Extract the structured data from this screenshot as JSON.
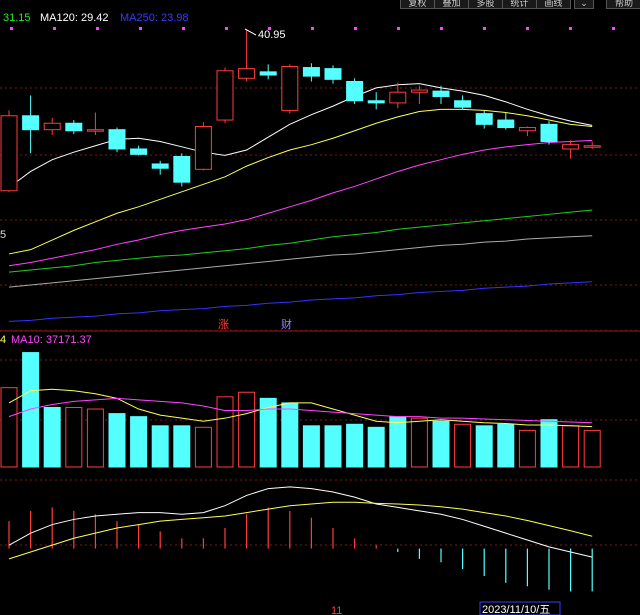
{
  "window": {
    "toolbar": [
      "复权",
      "叠加",
      "多股",
      "统计",
      "画线",
      "⌄",
      "帮助"
    ]
  },
  "price_legend": {
    "first_value": "31.15",
    "ma120": "MA120: 29.42",
    "ma250": "MA250: 23.98",
    "left_cut_label": "5"
  },
  "max_price_label": "40.95",
  "markers": {
    "zhang": "涨",
    "cai": "财"
  },
  "volume_legend": {
    "first_value": "4",
    "ma10": "MA10: 37171.37"
  },
  "axis": {
    "x_tick": "11",
    "date_label": "2023/11/10/五"
  },
  "colors": {
    "up": "#ff3c3c",
    "down": "#54ffff",
    "ma_short": "#ffffff",
    "ma_mid": "#ffff55",
    "ma_pink": "#ff44ff",
    "ma_green": "#22cc22",
    "ma_gray": "#aaaaaa",
    "ma_blue": "#3333ff",
    "grid": "#7a1a1a"
  },
  "chart_data": [
    {
      "type": "candlestick",
      "title": "",
      "series": [
        {
          "name": "price",
          "values": [
            {
              "o": 26.0,
              "h": 33.5,
              "l": 25.9,
              "c": 33.0
            },
            {
              "o": 33.0,
              "h": 34.9,
              "l": 29.5,
              "c": 31.7
            },
            {
              "o": 31.7,
              "h": 32.8,
              "l": 31.2,
              "c": 32.3
            },
            {
              "o": 32.3,
              "h": 32.6,
              "l": 31.3,
              "c": 31.6
            },
            {
              "o": 31.6,
              "h": 33.3,
              "l": 31.2,
              "c": 31.7
            },
            {
              "o": 31.7,
              "h": 31.9,
              "l": 29.6,
              "c": 29.9
            },
            {
              "o": 29.9,
              "h": 30.2,
              "l": 29.3,
              "c": 29.4
            },
            {
              "o": 28.5,
              "h": 28.8,
              "l": 27.5,
              "c": 28.1
            },
            {
              "o": 29.2,
              "h": 29.5,
              "l": 26.4,
              "c": 26.8
            },
            {
              "o": 28.0,
              "h": 32.4,
              "l": 27.9,
              "c": 32.0
            },
            {
              "o": 32.6,
              "h": 37.5,
              "l": 32.3,
              "c": 37.2
            },
            {
              "o": 36.5,
              "h": 40.95,
              "l": 36.2,
              "c": 37.4
            },
            {
              "o": 37.1,
              "h": 37.8,
              "l": 36.4,
              "c": 36.8
            },
            {
              "o": 33.5,
              "h": 37.8,
              "l": 33.2,
              "c": 37.6
            },
            {
              "o": 37.5,
              "h": 37.9,
              "l": 36.2,
              "c": 36.7
            },
            {
              "o": 37.4,
              "h": 37.7,
              "l": 36.0,
              "c": 36.4
            },
            {
              "o": 36.2,
              "h": 36.5,
              "l": 34.1,
              "c": 34.4
            },
            {
              "o": 34.4,
              "h": 35.2,
              "l": 33.6,
              "c": 34.2
            },
            {
              "o": 34.2,
              "h": 36.1,
              "l": 33.7,
              "c": 35.2
            },
            {
              "o": 35.2,
              "h": 35.8,
              "l": 34.1,
              "c": 35.4
            },
            {
              "o": 35.3,
              "h": 35.8,
              "l": 34.1,
              "c": 34.8
            },
            {
              "o": 34.4,
              "h": 34.9,
              "l": 33.6,
              "c": 33.8
            },
            {
              "o": 33.2,
              "h": 33.5,
              "l": 31.8,
              "c": 32.2
            },
            {
              "o": 32.6,
              "h": 33.3,
              "l": 31.7,
              "c": 31.9
            },
            {
              "o": 31.6,
              "h": 32.0,
              "l": 31.1,
              "c": 31.9
            },
            {
              "o": 32.2,
              "h": 32.5,
              "l": 30.3,
              "c": 30.6
            },
            {
              "o": 29.9,
              "h": 30.7,
              "l": 29.0,
              "c": 30.3
            },
            {
              "o": 30.1,
              "h": 30.6,
              "l": 29.9,
              "c": 30.2
            }
          ]
        },
        {
          "name": "MA5",
          "values": [
            26.3,
            27.8,
            28.9,
            29.6,
            30.2,
            30.8,
            30.9,
            30.6,
            30.1,
            29.6,
            29.3,
            29.8,
            31.0,
            32.2,
            33.1,
            33.9,
            34.8,
            35.6,
            35.9,
            36.0,
            35.6,
            35.3,
            34.9,
            34.3,
            33.6,
            33.0,
            32.5,
            32.1
          ]
        },
        {
          "name": "MA20",
          "values": [
            20.1,
            20.5,
            21.4,
            22.3,
            23.1,
            23.9,
            24.5,
            25.2,
            25.9,
            26.6,
            27.3,
            28.3,
            29.1,
            29.8,
            30.3,
            30.9,
            31.6,
            32.3,
            32.9,
            33.4,
            33.6,
            33.6,
            33.5,
            33.3,
            33.0,
            32.6,
            32.2,
            32.0
          ]
        },
        {
          "name": "MA60",
          "values": [
            19.0,
            19.3,
            19.7,
            20.1,
            20.5,
            21.0,
            21.4,
            21.9,
            22.3,
            22.6,
            22.9,
            23.3,
            23.9,
            24.5,
            25.1,
            25.8,
            26.4,
            27.1,
            27.8,
            28.4,
            28.9,
            29.4,
            29.8,
            30.1,
            30.3,
            30.5,
            30.6,
            30.7
          ]
        },
        {
          "name": "MA120",
          "values": [
            18.4,
            18.6,
            18.8,
            19.0,
            19.3,
            19.5,
            19.7,
            19.9,
            20.0,
            20.2,
            20.4,
            20.6,
            20.9,
            21.1,
            21.4,
            21.7,
            21.9,
            22.1,
            22.4,
            22.6,
            22.8,
            23.0,
            23.2,
            23.4,
            23.6,
            23.8,
            24.0,
            24.2
          ]
        },
        {
          "name": "MA250",
          "values": [
            17.0,
            17.2,
            17.4,
            17.6,
            17.8,
            18.0,
            18.2,
            18.4,
            18.6,
            18.8,
            19.0,
            19.2,
            19.4,
            19.6,
            19.8,
            20.0,
            20.1,
            20.3,
            20.5,
            20.7,
            20.9,
            21.0,
            21.2,
            21.3,
            21.5,
            21.6,
            21.7,
            21.8
          ]
        },
        {
          "name": "MA_long",
          "values": [
            13.8,
            13.9,
            14.1,
            14.2,
            14.3,
            14.5,
            14.6,
            14.8,
            14.9,
            15.0,
            15.2,
            15.3,
            15.5,
            15.6,
            15.8,
            15.9,
            16.0,
            16.2,
            16.3,
            16.5,
            16.6,
            16.7,
            16.9,
            17.0,
            17.1,
            17.3,
            17.4,
            17.5
          ]
        }
      ],
      "ylim": [
        13,
        42.5
      ]
    },
    {
      "type": "bar",
      "title": "",
      "series": [
        {
          "name": "volume",
          "values": [
            52000,
            75000,
            39000,
            39000,
            38000,
            35000,
            33000,
            27000,
            27000,
            26000,
            46000,
            49000,
            45000,
            42000,
            27000,
            27000,
            28000,
            26000,
            33000,
            32000,
            30000,
            28000,
            27000,
            28000,
            24000,
            31000,
            27000,
            24000
          ],
          "up": [
            1,
            0,
            0,
            1,
            1,
            0,
            0,
            0,
            0,
            1,
            1,
            1,
            0,
            0,
            0,
            0,
            0,
            0,
            0,
            1,
            0,
            1,
            0,
            0,
            1,
            0,
            1,
            1
          ]
        },
        {
          "name": "MA5",
          "values": [
            42000,
            50000,
            51000,
            50000,
            48000,
            45000,
            38000,
            34000,
            32000,
            30000,
            32000,
            35000,
            39000,
            42000,
            42000,
            38000,
            34000,
            30000,
            29000,
            30000,
            31000,
            30000,
            29000,
            28500,
            27500,
            27500,
            27000,
            26500
          ]
        },
        {
          "name": "MA10",
          "values": [
            33000,
            38000,
            41000,
            43000,
            44000,
            45000,
            44000,
            43000,
            42000,
            40000,
            37000,
            37000,
            38000,
            38000,
            37000,
            36000,
            35000,
            34000,
            33000,
            33000,
            32000,
            32000,
            31500,
            31000,
            30500,
            30000,
            29500,
            29000
          ]
        }
      ],
      "ylim": [
        0,
        78000
      ]
    },
    {
      "type": "line",
      "title": "",
      "series": [
        {
          "name": "DIF",
          "values": [
            0.1,
            0.45,
            0.7,
            0.85,
            0.95,
            1.0,
            1.05,
            1.05,
            1.0,
            1.05,
            1.25,
            1.55,
            1.75,
            1.8,
            1.75,
            1.65,
            1.5,
            1.3,
            1.2,
            1.1,
            1.0,
            0.85,
            0.65,
            0.45,
            0.25,
            0.05,
            -0.1,
            -0.25
          ]
        },
        {
          "name": "DEA",
          "values": [
            -0.3,
            -0.1,
            0.1,
            0.3,
            0.45,
            0.6,
            0.7,
            0.8,
            0.85,
            0.9,
            0.95,
            1.05,
            1.15,
            1.25,
            1.3,
            1.35,
            1.35,
            1.32,
            1.3,
            1.27,
            1.22,
            1.15,
            1.05,
            0.95,
            0.82,
            0.67,
            0.52,
            0.36
          ]
        },
        {
          "name": "MACD",
          "values": [
            0.8,
            1.1,
            1.2,
            1.1,
            1.0,
            0.8,
            0.7,
            0.5,
            0.3,
            0.3,
            0.6,
            1.0,
            1.2,
            1.1,
            0.9,
            0.6,
            0.3,
            0.1,
            -0.1,
            -0.3,
            -0.4,
            -0.6,
            -0.8,
            -1.0,
            -1.1,
            -1.2,
            -1.25,
            -1.25
          ]
        }
      ],
      "ylim": [
        -1.5,
        2.0
      ]
    }
  ]
}
